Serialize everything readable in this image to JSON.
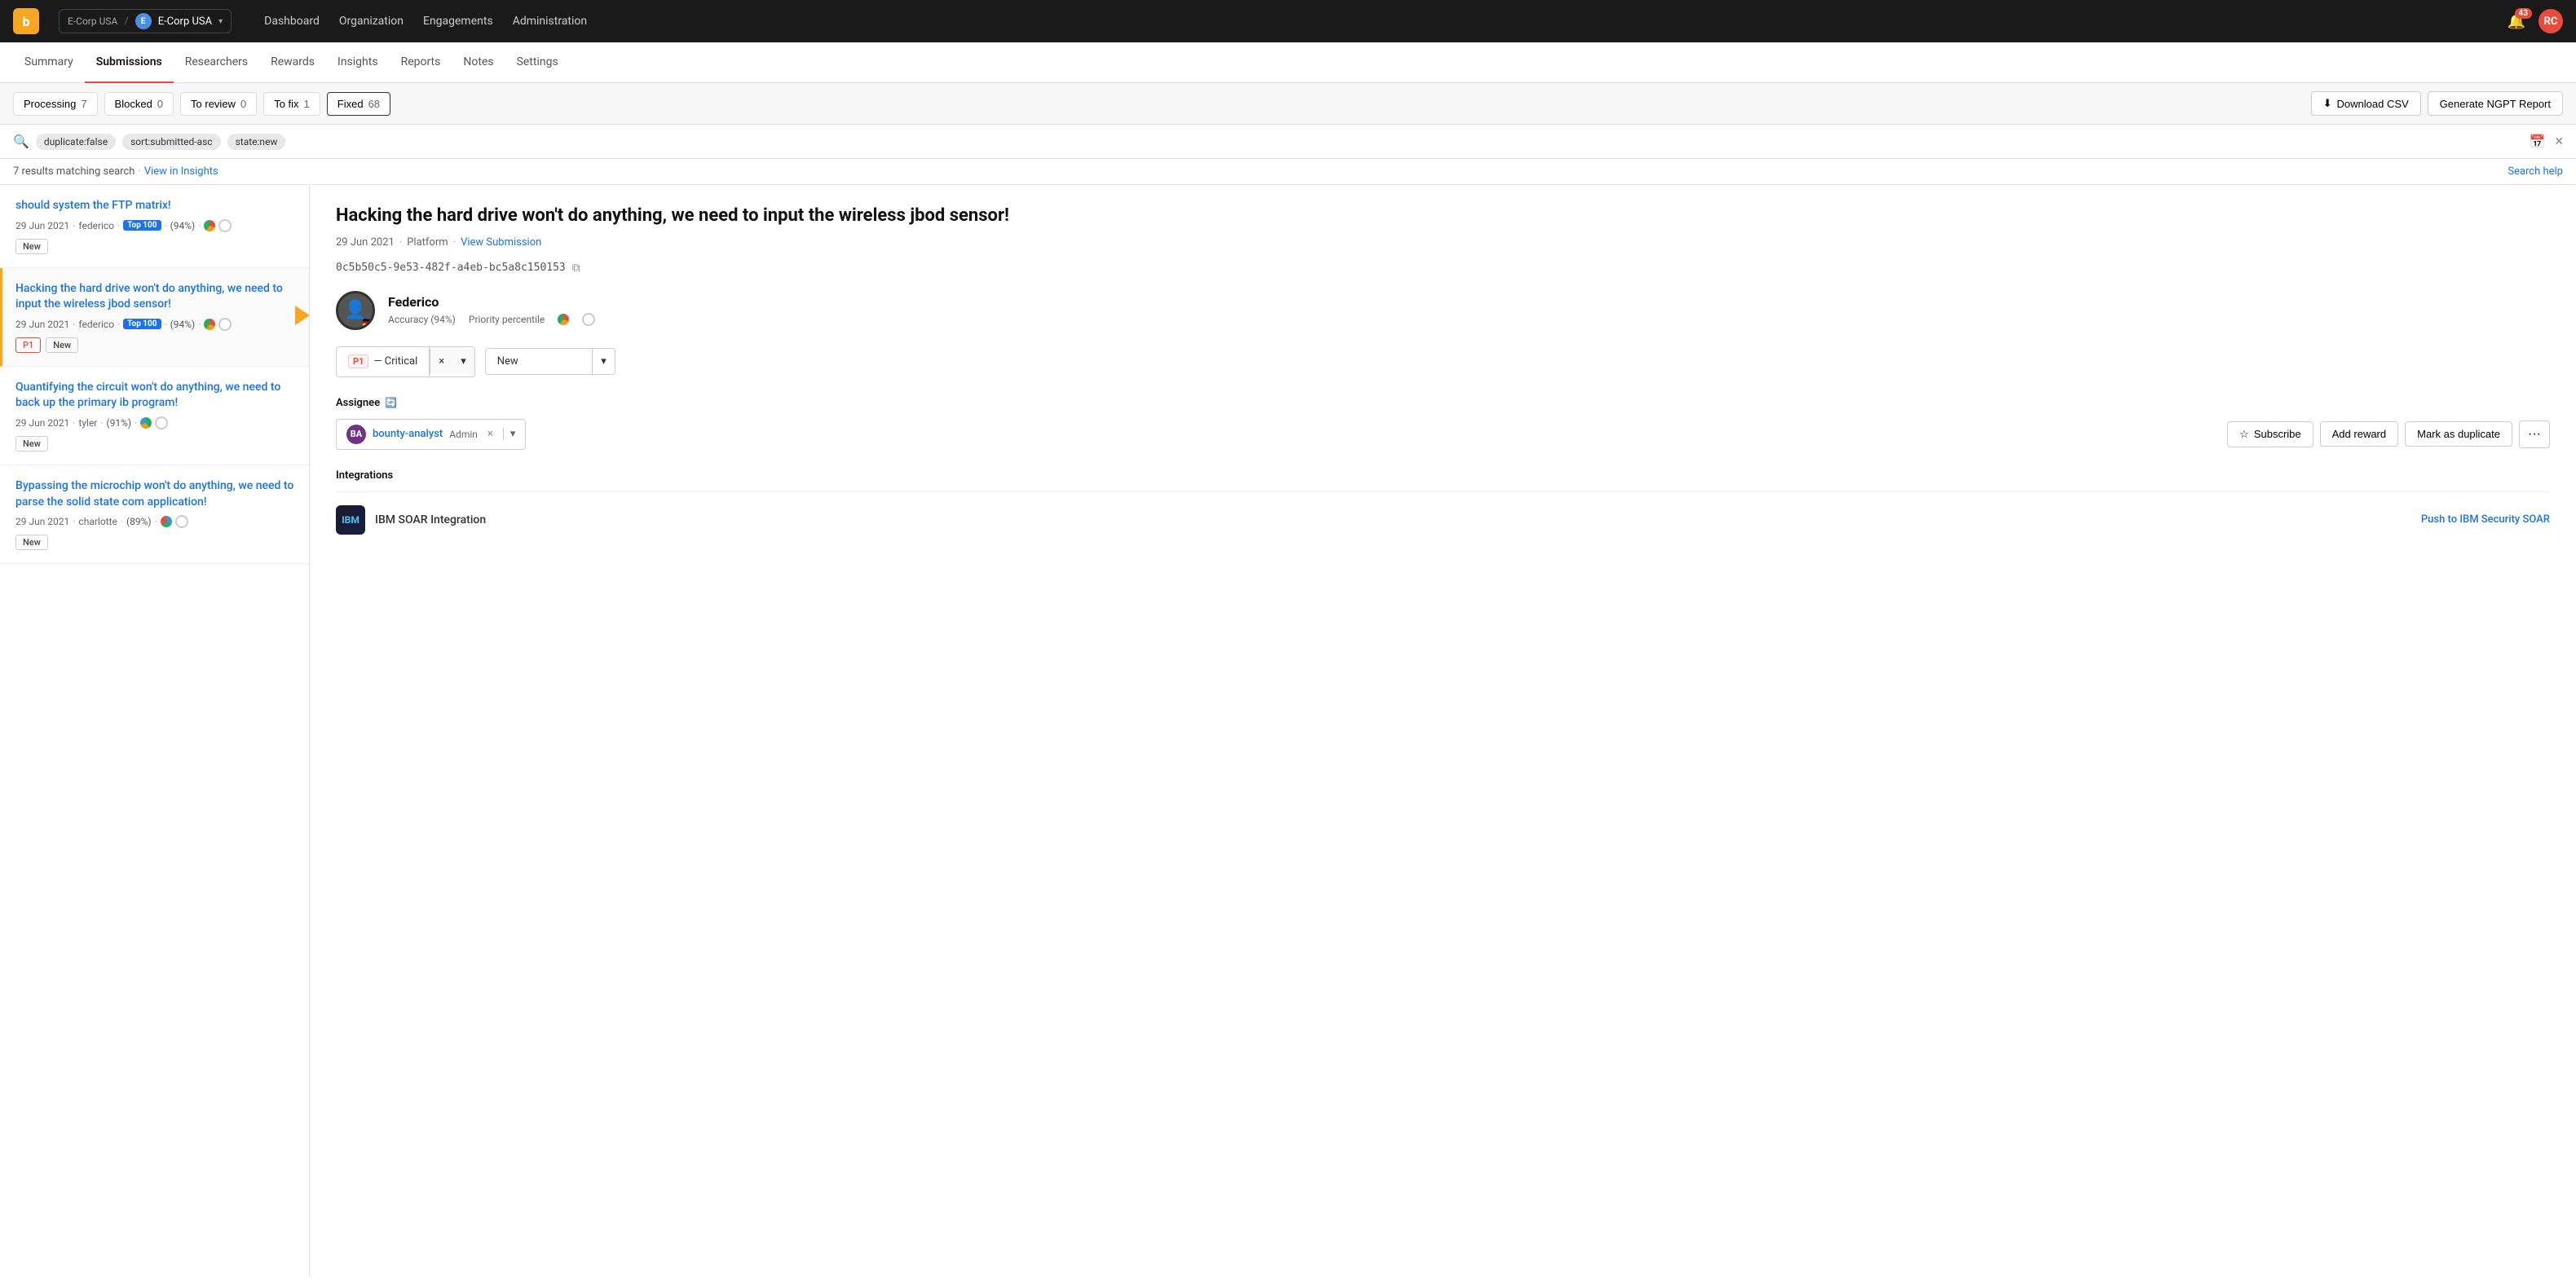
{
  "topnav": {
    "logo": "b",
    "org_path": "E-Corp USA",
    "org_name": "E-Corp USA",
    "links": [
      "Dashboard",
      "Organization",
      "Engagements",
      "Administration"
    ],
    "notification_count": "43",
    "avatar_initials": "RC"
  },
  "subnav": {
    "tabs": [
      "Summary",
      "Submissions",
      "Researchers",
      "Rewards",
      "Insights",
      "Reports",
      "Notes",
      "Settings"
    ],
    "active": "Submissions"
  },
  "filters": {
    "processing_label": "Processing",
    "processing_count": "7",
    "blocked_label": "Blocked",
    "blocked_count": "0",
    "to_review_label": "To review",
    "to_review_count": "0",
    "to_fix_label": "To fix",
    "to_fix_count": "1",
    "fixed_label": "Fixed",
    "fixed_count": "68",
    "download_csv": "Download CSV",
    "generate_ngpt": "Generate NGPT Report"
  },
  "search": {
    "tags": [
      "duplicate:false",
      "sort:submitted-asc",
      "state:new"
    ],
    "results_text": "7 results matching search",
    "view_insights": "View in Insights",
    "search_help": "Search help"
  },
  "submissions": [
    {
      "id": "sub1",
      "title": "should system the FTP matrix!",
      "date": "29 Jun 2021",
      "author": "federico",
      "top100": true,
      "accuracy": "(94%)",
      "tags": [
        "New"
      ],
      "priority": null,
      "selected": false
    },
    {
      "id": "sub2",
      "title": "Hacking the hard drive won't do anything, we need to input the wireless jbod sensor!",
      "date": "29 Jun 2021",
      "author": "federico",
      "top100": true,
      "accuracy": "(94%)",
      "tags": [
        "P1",
        "New"
      ],
      "priority": "P1",
      "selected": true
    },
    {
      "id": "sub3",
      "title": "Quantifying the circuit won't do anything, we need to back up the primary ib program!",
      "date": "29 Jun 2021",
      "author": "tyler",
      "top100": false,
      "accuracy": "(91%)",
      "tags": [
        "New"
      ],
      "priority": null,
      "selected": false
    },
    {
      "id": "sub4",
      "title": "Bypassing the microchip won't do anything, we need to parse the solid state com application!",
      "date": "29 Jun 2021",
      "author": "charlotte",
      "top100": false,
      "accuracy": "(89%)",
      "tags": [
        "New"
      ],
      "priority": null,
      "selected": false
    }
  ],
  "detail": {
    "title": "Hacking the hard drive won't do anything, we need to input the wireless jbod sensor!",
    "date": "29 Jun 2021",
    "platform": "Platform",
    "view_submission": "View Submission",
    "uuid": "0c5b50c5-9e53-482f-a4eb-bc5a8c150153",
    "reporter_name": "Federico",
    "reporter_accuracy": "Accuracy (94%)",
    "reporter_priority": "Priority percentile",
    "priority_label": "P1",
    "priority_text": "— Critical",
    "state_label": "New",
    "assignee_section_label": "Assignee",
    "assignee_name": "bounty-analyst",
    "assignee_role": "Admin",
    "subscribe_label": "Subscribe",
    "add_reward_label": "Add reward",
    "mark_duplicate_label": "Mark as duplicate",
    "integrations_label": "Integrations",
    "ibm_integration": "IBM SOAR Integration",
    "push_ibm_label": "Push to IBM Security SOAR"
  }
}
